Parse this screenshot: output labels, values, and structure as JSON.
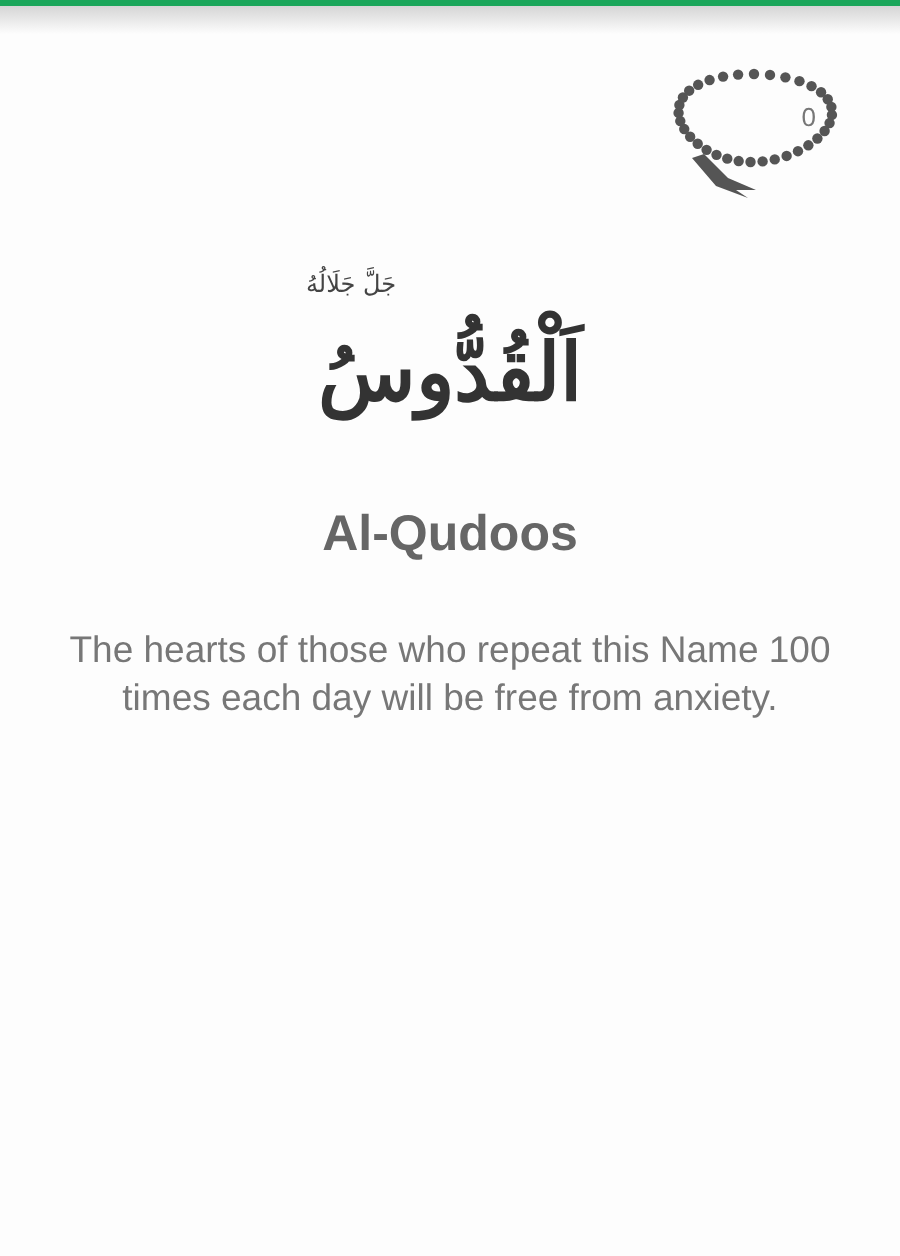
{
  "counter": {
    "count": "0"
  },
  "name": {
    "arabic": "اَلْقُدُّوسُ",
    "honorific": "جَلَّ جَلَالُهُ",
    "transliteration": "Al-Qudoos"
  },
  "description": "The hearts of those who repeat this Name 100 times each day will be free from anxiety."
}
